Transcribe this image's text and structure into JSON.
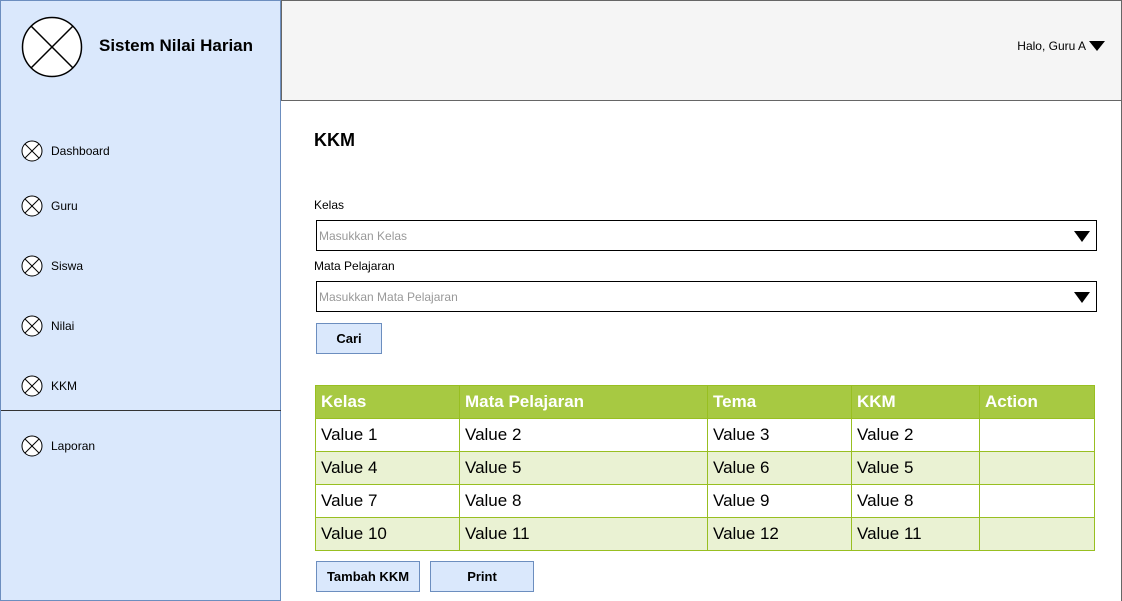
{
  "app": {
    "title": "Sistem Nilai Harian"
  },
  "header": {
    "user_label": "Halo, Guru A"
  },
  "sidebar": {
    "items": [
      {
        "label": "Dashboard",
        "icon": "x-circle-icon"
      },
      {
        "label": "Guru",
        "icon": "x-circle-icon"
      },
      {
        "label": "Siswa",
        "icon": "x-circle-icon"
      },
      {
        "label": "Nilai",
        "icon": "x-circle-icon"
      },
      {
        "label": "KKM",
        "icon": "x-circle-icon"
      },
      {
        "label": "Laporan",
        "icon": "x-circle-icon"
      }
    ]
  },
  "main": {
    "title": "KKM",
    "kelas": {
      "label": "Kelas",
      "placeholder": "Masukkan Kelas"
    },
    "mapel": {
      "label": "Mata Pelajaran",
      "placeholder": "Masukkan Mata Pelajaran"
    },
    "search_label": "Cari",
    "table": {
      "headers": [
        "Kelas",
        "Mata Pelajaran",
        "Tema",
        "KKM",
        "Action"
      ],
      "rows": [
        [
          "Value 1",
          "Value 2",
          "Value 3",
          "Value 2",
          ""
        ],
        [
          "Value 4",
          "Value 5",
          "Value 6",
          "Value 5",
          ""
        ],
        [
          "Value 7",
          "Value 8",
          "Value 9",
          "Value 8",
          ""
        ],
        [
          "Value 10",
          "Value 11",
          "Value 12",
          "Value 11",
          ""
        ]
      ]
    },
    "add_label": "Tambah KKM",
    "print_label": "Print"
  },
  "colors": {
    "sidebar_bg": "#dae8fc",
    "table_header": "#a7c942",
    "table_alt_row": "#eaf2d3"
  }
}
